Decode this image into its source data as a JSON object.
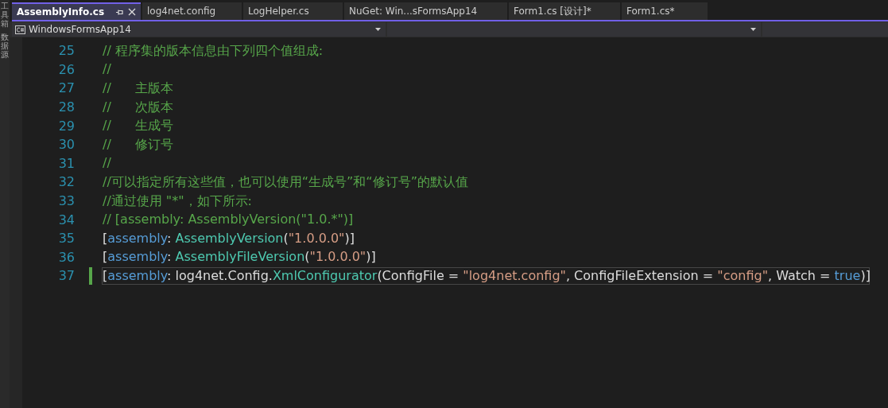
{
  "side_strip": {
    "labels": [
      "工具箱",
      "数据源"
    ]
  },
  "tabs": [
    {
      "label": "AssemblyInfo.cs",
      "selected": true,
      "pinnable": true
    },
    {
      "label": "log4net.config",
      "selected": false,
      "pinnable": false
    },
    {
      "label": "LogHelper.cs",
      "selected": false,
      "pinnable": false
    },
    {
      "label": "NuGet: Win...sFormsApp14",
      "selected": false,
      "pinnable": false
    },
    {
      "label": "Form1.cs [设计]*",
      "selected": false,
      "pinnable": false
    },
    {
      "label": "Form1.cs*",
      "selected": false,
      "pinnable": false
    }
  ],
  "nav_bar": {
    "project": "WindowsFormsApp14"
  },
  "code_lines": [
    {
      "number": "25",
      "current": false,
      "tokens": [
        {
          "kind": "comment",
          "text": "// 程序集的版本信息由下列四个值组成:"
        }
      ]
    },
    {
      "number": "26",
      "current": false,
      "tokens": [
        {
          "kind": "comment",
          "text": "//"
        }
      ]
    },
    {
      "number": "27",
      "current": false,
      "tokens": [
        {
          "kind": "comment",
          "text": "//      主版本"
        }
      ]
    },
    {
      "number": "28",
      "current": false,
      "tokens": [
        {
          "kind": "comment",
          "text": "//      次版本"
        }
      ]
    },
    {
      "number": "29",
      "current": false,
      "tokens": [
        {
          "kind": "comment",
          "text": "//      生成号"
        }
      ]
    },
    {
      "number": "30",
      "current": false,
      "tokens": [
        {
          "kind": "comment",
          "text": "//      修订号"
        }
      ]
    },
    {
      "number": "31",
      "current": false,
      "tokens": [
        {
          "kind": "comment",
          "text": "//"
        }
      ]
    },
    {
      "number": "32",
      "current": false,
      "tokens": [
        {
          "kind": "comment",
          "text": "//可以指定所有这些值，也可以使用“生成号”和“修订号”的默认值"
        }
      ]
    },
    {
      "number": "33",
      "current": false,
      "tokens": [
        {
          "kind": "comment",
          "text": "//通过使用 \"*\"，如下所示:"
        }
      ]
    },
    {
      "number": "34",
      "current": false,
      "tokens": [
        {
          "kind": "comment",
          "text": "// [assembly: AssemblyVersion(\"1.0.*\")]"
        }
      ]
    },
    {
      "number": "35",
      "current": false,
      "tokens": [
        {
          "kind": "plain",
          "text": "["
        },
        {
          "kind": "keyword",
          "text": "assembly"
        },
        {
          "kind": "plain",
          "text": ": "
        },
        {
          "kind": "type",
          "text": "AssemblyVersion"
        },
        {
          "kind": "plain",
          "text": "("
        },
        {
          "kind": "string",
          "text": "\"1.0.0.0\""
        },
        {
          "kind": "plain",
          "text": ")]"
        }
      ]
    },
    {
      "number": "36",
      "current": false,
      "tokens": [
        {
          "kind": "plain",
          "text": "["
        },
        {
          "kind": "keyword",
          "text": "assembly"
        },
        {
          "kind": "plain",
          "text": ": "
        },
        {
          "kind": "type",
          "text": "AssemblyFileVersion"
        },
        {
          "kind": "plain",
          "text": "("
        },
        {
          "kind": "string",
          "text": "\"1.0.0.0\""
        },
        {
          "kind": "plain",
          "text": ")]"
        }
      ]
    },
    {
      "number": "37",
      "current": true,
      "tokens": [
        {
          "kind": "plain",
          "text": "["
        },
        {
          "kind": "keyword",
          "text": "assembly"
        },
        {
          "kind": "plain",
          "text": ": log4net.Config."
        },
        {
          "kind": "type",
          "text": "XmlConfigurator"
        },
        {
          "kind": "plain",
          "text": "(ConfigFile = "
        },
        {
          "kind": "string",
          "text": "\"log4net.config\""
        },
        {
          "kind": "plain",
          "text": ", ConfigFileExtension = "
        },
        {
          "kind": "string",
          "text": "\"config\""
        },
        {
          "kind": "plain",
          "text": ", Watch = "
        },
        {
          "kind": "keyword",
          "text": "true"
        },
        {
          "kind": "plain",
          "text": ")]"
        }
      ]
    }
  ]
}
